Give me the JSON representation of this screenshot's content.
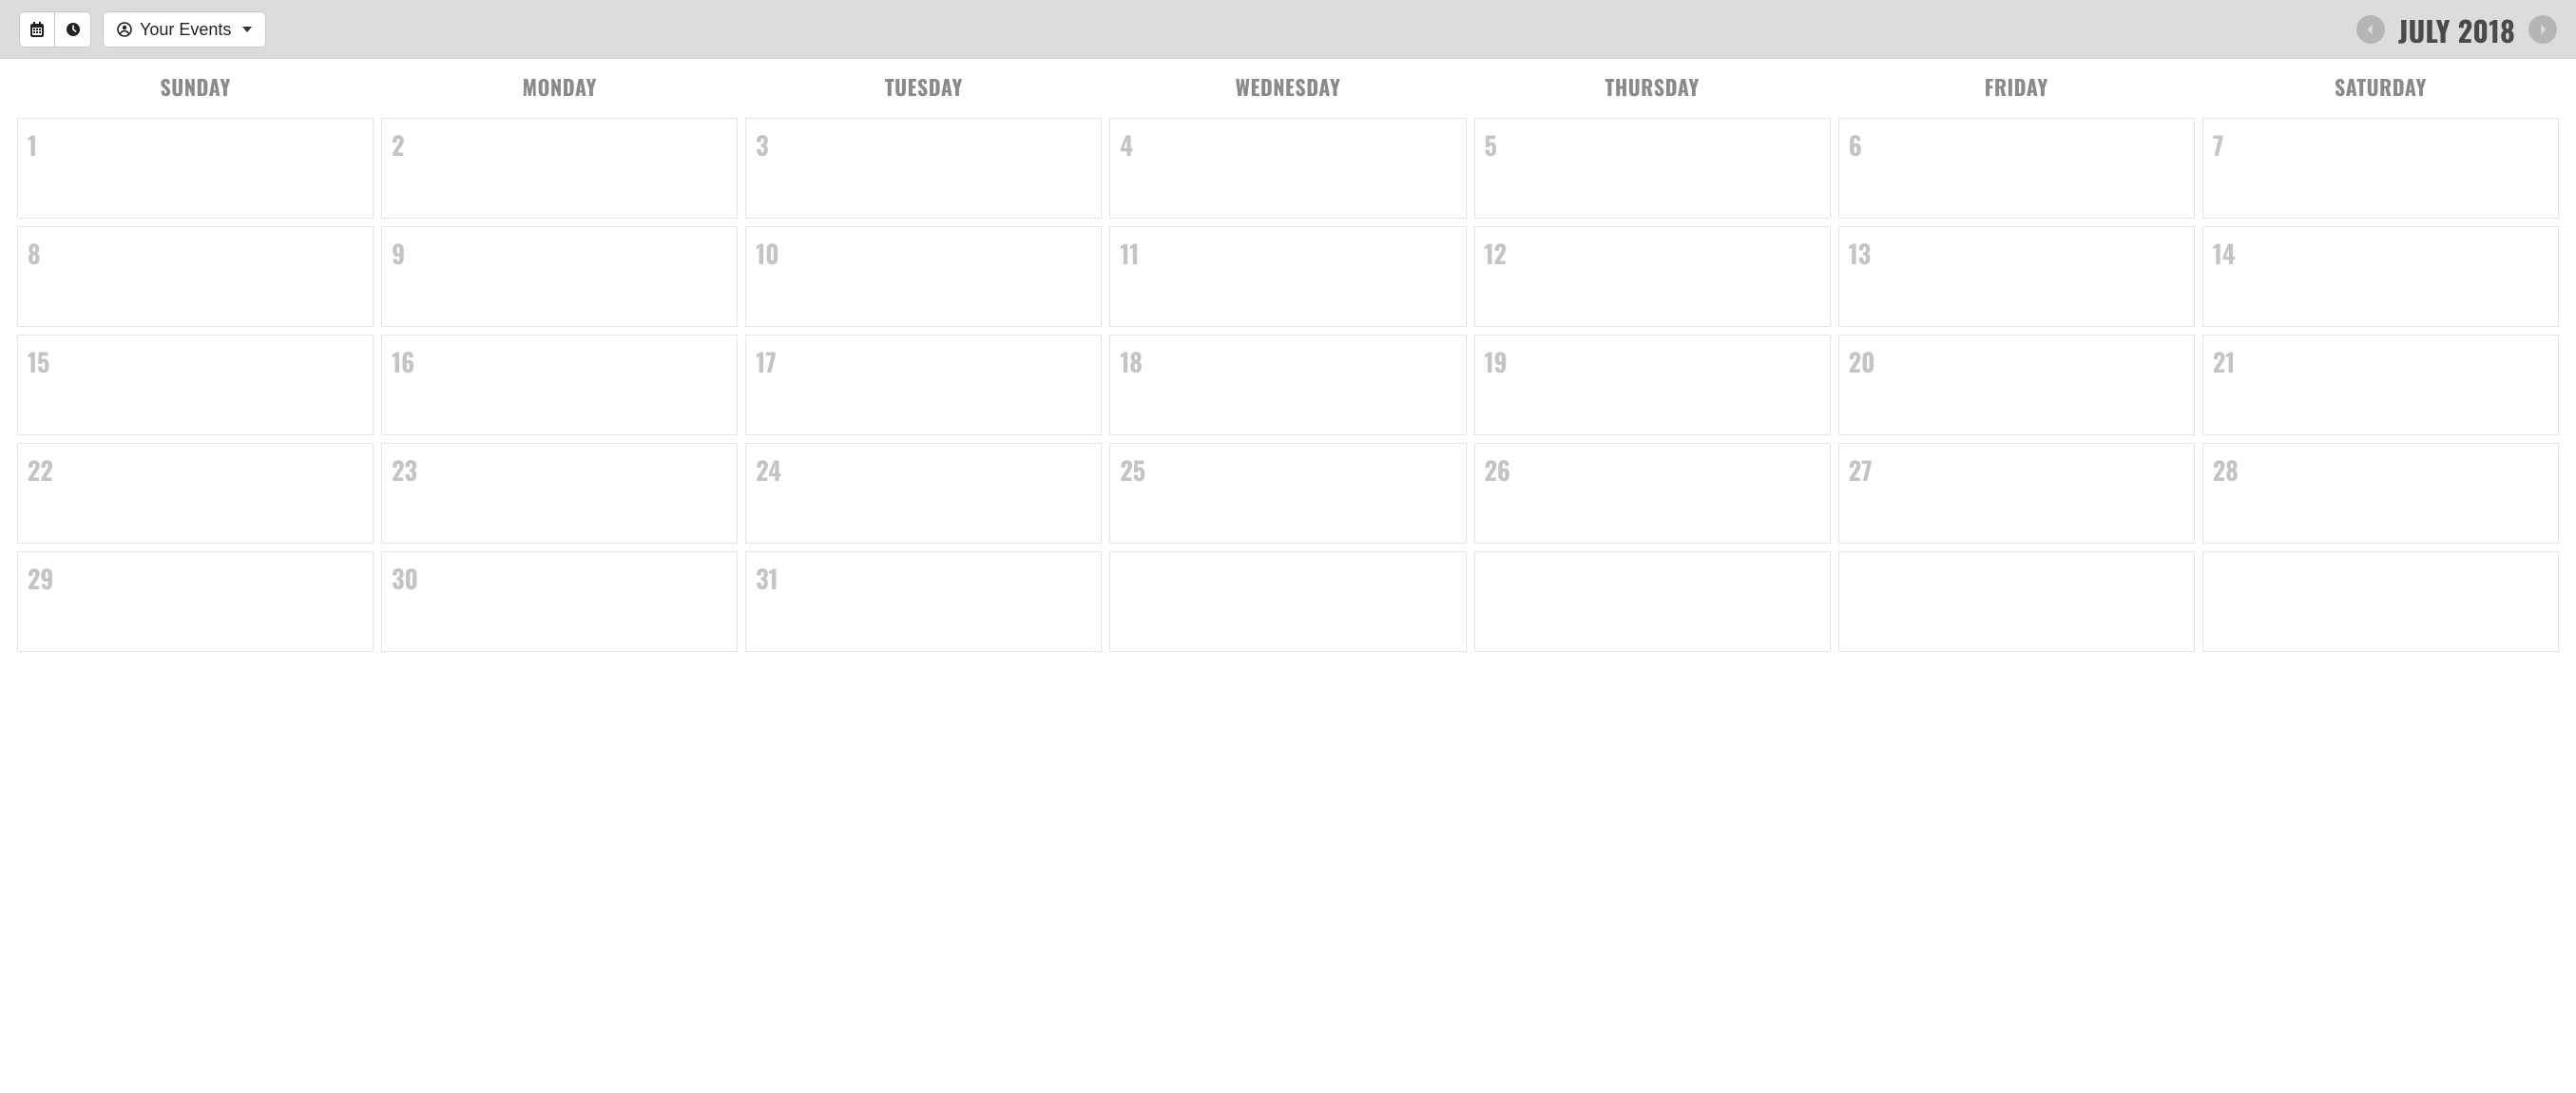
{
  "toolbar": {
    "dropdown_label": "Your Events"
  },
  "month_nav": {
    "title": "JULY 2018"
  },
  "days_of_week": [
    "SUNDAY",
    "MONDAY",
    "TUESDAY",
    "WEDNESDAY",
    "THURSDAY",
    "FRIDAY",
    "SATURDAY"
  ],
  "weeks": [
    [
      "1",
      "2",
      "3",
      "4",
      "5",
      "6",
      "7"
    ],
    [
      "8",
      "9",
      "10",
      "11",
      "12",
      "13",
      "14"
    ],
    [
      "15",
      "16",
      "17",
      "18",
      "19",
      "20",
      "21"
    ],
    [
      "22",
      "23",
      "24",
      "25",
      "26",
      "27",
      "28"
    ],
    [
      "29",
      "30",
      "31",
      "",
      "",
      "",
      ""
    ]
  ]
}
